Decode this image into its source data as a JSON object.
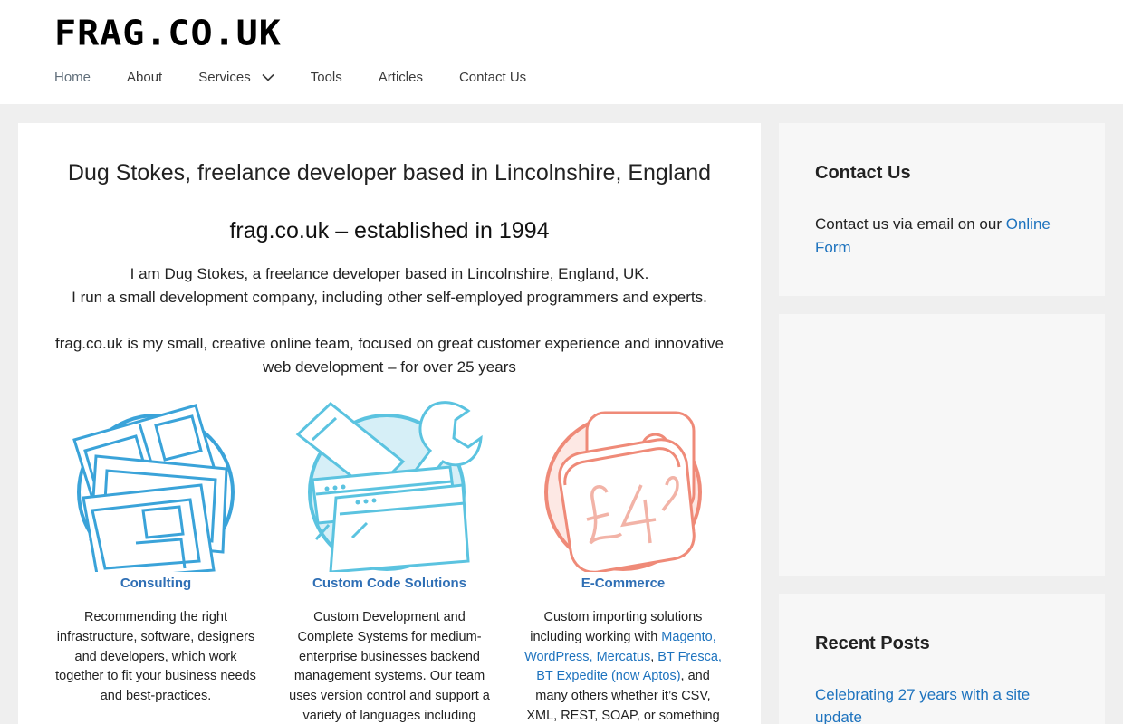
{
  "header": {
    "logo": "FRAG.CO.UK",
    "nav": [
      {
        "label": "Home"
      },
      {
        "label": "About"
      },
      {
        "label": "Services"
      },
      {
        "label": "Tools"
      },
      {
        "label": "Articles"
      },
      {
        "label": "Contact Us"
      }
    ],
    "services_dropdown_icon": "chevron-down-icon"
  },
  "main": {
    "title": "Dug Stokes, freelance developer based in Lincolnshire, England",
    "subtitle": "frag.co.uk – established in 1994",
    "intro_line1": "I am Dug Stokes, a freelance developer based in Lincolnshire, England, UK.",
    "intro_line2": "I run a small development company, including other self-employed programmers and experts.",
    "intro_para2": "frag.co.uk is my small, creative online team, focused on great customer experience and innovative web development – for over 25 years",
    "features": [
      {
        "icon": "documents-icon",
        "title": "Consulting",
        "description": "Recommending the right infrastructure, software, designers and developers, which work together to fit your business needs and best-practices.",
        "color": "#3aa3d9"
      },
      {
        "icon": "tools-browser-icon",
        "title": "Custom Code Solutions",
        "description": "Custom Development and Complete Systems for medium-enterprise businesses backend management systems. Our team uses version control and support a variety of languages including PHP",
        "color": "#5bc3e0"
      },
      {
        "icon": "pound-cards-icon",
        "title": "E-Commerce",
        "description_pre": "Custom importing solutions including working with ",
        "link1": "Magento, WordPress, Mercatus",
        "sep": ", ",
        "link2": "BT Fresca, BT Expedite (now Aptos)",
        "description_post": ", and many others whether it’s CSV, XML, REST, SOAP, or something",
        "color": "#ef8a78"
      }
    ]
  },
  "sidebar": {
    "contact": {
      "title": "Contact Us",
      "text": "Contact us via email on our ",
      "link": "Online Form"
    },
    "recent": {
      "title": "Recent Posts",
      "posts": [
        "Celebrating 27 years with a site update"
      ]
    }
  },
  "colors": {
    "link": "#1e73be",
    "feature_title": "#2f6fb5",
    "page_bg": "#efefef",
    "widget_bg": "#f7f7f7"
  }
}
